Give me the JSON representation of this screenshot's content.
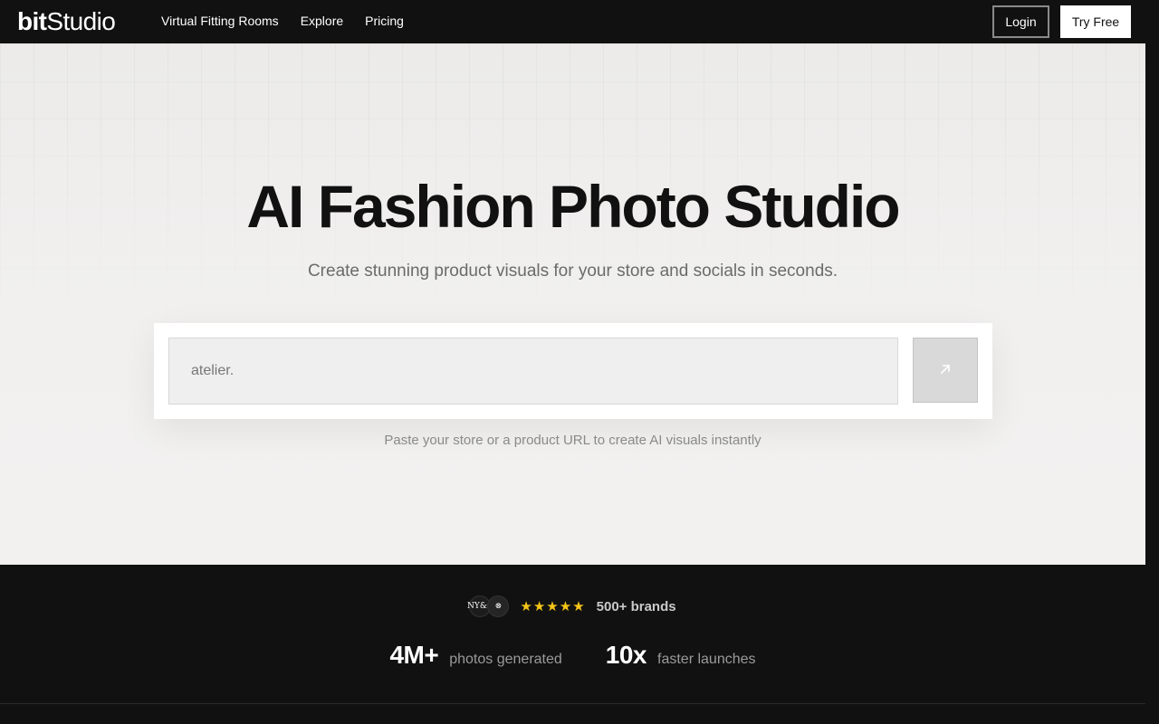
{
  "header": {
    "logo_bold": "bit",
    "logo_light": "Studio",
    "nav": [
      {
        "label": "Virtual Fitting Rooms"
      },
      {
        "label": "Explore"
      },
      {
        "label": "Pricing"
      }
    ],
    "login_label": "Login",
    "try_label": "Try Free"
  },
  "hero": {
    "title": "AI Fashion Photo Studio",
    "subtitle": "Create stunning product visuals for your store and socials in seconds.",
    "input_value": "atelier.",
    "submit_icon": "arrow-up-right-icon",
    "hint": "Paste your store or a product URL to create AI visuals instantly"
  },
  "stats": {
    "brand_logo_1": "NY&C",
    "brand_logo_2": "⊗",
    "rating_stars": 5,
    "brands_label": "500+ brands",
    "metrics": [
      {
        "value": "4M+",
        "label": "photos generated"
      },
      {
        "value": "10x",
        "label": "faster launches"
      }
    ]
  },
  "colors": {
    "header_bg": "#111111",
    "hero_bg": "#efeeed",
    "star": "#f5c518",
    "accent_white": "#ffffff"
  }
}
